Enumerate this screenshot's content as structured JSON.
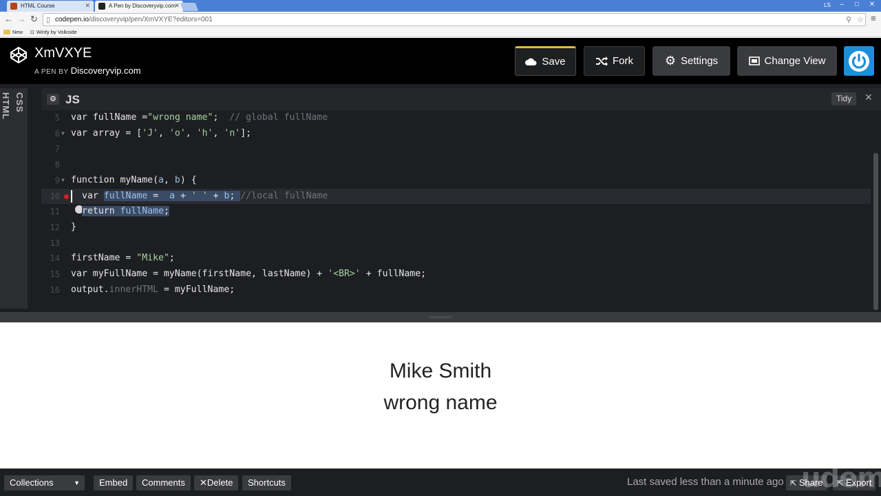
{
  "browser": {
    "tabs": [
      {
        "label": "HTML Course",
        "active": false
      },
      {
        "label": "A Pen by Discoveryvip.com",
        "active": true
      }
    ],
    "user_badge": "LS",
    "url_host": "codepen.io",
    "url_path": "/discoveryvip/pen/XmVXYE?editors=001",
    "bookmarks": [
      "New",
      "Winfy by Volkside"
    ]
  },
  "header": {
    "pen_title": "XmVXYE",
    "pen_by_prefix": "A PEN BY",
    "pen_author": "Discoveryvip.com",
    "buttons": {
      "save": "Save",
      "fork": "Fork",
      "settings": "Settings",
      "change_view": "Change View"
    }
  },
  "editor": {
    "side_tabs": [
      "HTML",
      "CSS"
    ],
    "pane_title": "JS",
    "tidy_label": "Tidy",
    "close_glyph": "✕",
    "lines": [
      {
        "n": "5",
        "fold": false
      },
      {
        "n": "6",
        "fold": true
      },
      {
        "n": "7",
        "fold": false
      },
      {
        "n": "8",
        "fold": false
      },
      {
        "n": "9",
        "fold": true
      },
      {
        "n": "10",
        "fold": false
      },
      {
        "n": "11",
        "fold": false
      },
      {
        "n": "12",
        "fold": false
      },
      {
        "n": "13",
        "fold": false
      },
      {
        "n": "14",
        "fold": false
      },
      {
        "n": "15",
        "fold": false
      },
      {
        "n": "16",
        "fold": false
      }
    ],
    "code": {
      "l5_a": "var fullName =",
      "l5_b": "\"wrong name\"",
      "l5_c": ";  ",
      "l5_cmt": "// global fullName",
      "l6_a": "var array = [",
      "l6_s1": "'J'",
      "l6_s2": "'o'",
      "l6_s3": "'h'",
      "l6_s4": "'n'",
      "l6_end": "];",
      "comma": ", ",
      "l9_a": "function myName(",
      "l9_p1": "a",
      "l9_p2": "b",
      "l9_end": ") {",
      "l10_a": "var ",
      "l10_v": "fullName",
      "l10_b": " =  ",
      "l10_p1": "a",
      "l10_c": " + ",
      "l10_s": "' '",
      "l10_d": " + ",
      "l10_p2": "b",
      "l10_e": "; ",
      "l10_cmt": "//local fullName",
      "l11_a": "return ",
      "l11_v": "fullName",
      "l11_e": ";",
      "l12": "}",
      "l14_a": "firstName = ",
      "l14_s": "\"Mike\"",
      "l14_e": ";",
      "l15_a": "var myFullName = myName(firstName, lastName) + ",
      "l15_s": "'<BR>'",
      "l15_e": " + fullName;",
      "l16_a": "output.",
      "l16_p": "innerHTML",
      "l16_e": " = myFullName;"
    }
  },
  "preview": {
    "line1": "Mike Smith",
    "line2": "wrong name"
  },
  "footer": {
    "collections": "Collections",
    "embed": "Embed",
    "comments": "Comments",
    "delete": "Delete",
    "shortcuts": "Shortcuts",
    "last_saved": "Last saved less than a minute ago",
    "share": "Share",
    "export": "Export",
    "watermark": "udemy"
  }
}
